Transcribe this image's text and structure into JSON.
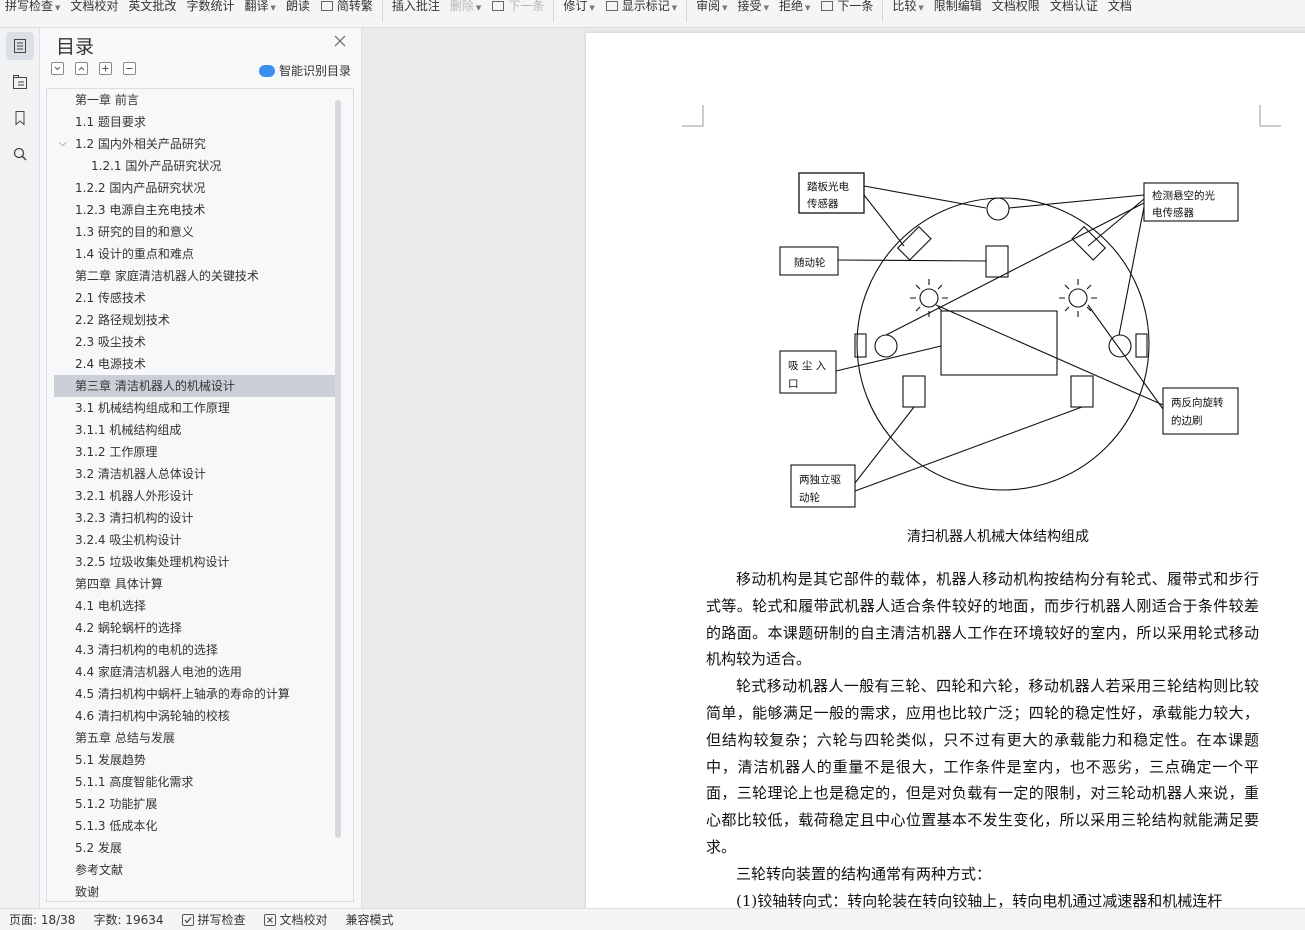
{
  "toolbar": {
    "items": [
      {
        "label": "拼写检查",
        "arrow": true
      },
      {
        "label": "文档校对"
      },
      {
        "label": "英文批改"
      },
      {
        "label": "字数统计"
      },
      {
        "label": "翻译",
        "arrow": true
      },
      {
        "label": "朗读"
      },
      {
        "label": "简转繁"
      },
      {
        "label": "插入批注"
      },
      {
        "label": "删除",
        "arrow": true
      },
      {
        "label": "下一条"
      },
      {
        "label": "修订",
        "arrow": true
      },
      {
        "label": "显示标记",
        "arrow": true
      },
      {
        "label": "审阅",
        "arrow": true
      },
      {
        "label": "接受",
        "arrow": true
      },
      {
        "label": "拒绝",
        "arrow": true
      },
      {
        "label": "下一条"
      },
      {
        "label": "比较",
        "arrow": true
      },
      {
        "label": "限制编辑"
      },
      {
        "label": "文档权限"
      },
      {
        "label": "文档认证"
      },
      {
        "label": "文档"
      }
    ]
  },
  "rail": {
    "icons": [
      "toc-icon",
      "navigation-icon",
      "bookmark-icon",
      "search-icon"
    ]
  },
  "toc": {
    "title": "目录",
    "smart_label": "智能识别目录",
    "items": [
      {
        "label": "第一章  前言",
        "level": 1
      },
      {
        "label": "1.1 题目要求",
        "level": 2
      },
      {
        "label": "1.2 国内外相关产品研究",
        "level": 2,
        "expanded": true
      },
      {
        "label": "1.2.1 国外产品研究状况",
        "level": 3
      },
      {
        "label": "1.2.2 国内产品研究状况",
        "level": 2
      },
      {
        "label": "1.2.3 电源自主充电技术",
        "level": 2
      },
      {
        "label": "1.3 研究的目的和意义",
        "level": 2
      },
      {
        "label": "1.4 设计的重点和难点",
        "level": 2
      },
      {
        "label": "第二章  家庭清洁机器人的关键技术",
        "level": 1
      },
      {
        "label": "2.1 传感技术",
        "level": 2
      },
      {
        "label": "2.2 路径规划技术",
        "level": 2
      },
      {
        "label": "2.3 吸尘技术",
        "level": 2
      },
      {
        "label": "2.4 电源技术",
        "level": 2
      },
      {
        "label": "第三章  清洁机器人的机械设计",
        "level": 1,
        "selected": true
      },
      {
        "label": "3.1 机械结构组成和工作原理",
        "level": 2
      },
      {
        "label": "3.1.1    机械结构组成",
        "level": 2
      },
      {
        "label": "3.1.2 工作原理",
        "level": 2
      },
      {
        "label": "3.2 清洁机器人总体设计",
        "level": 2
      },
      {
        "label": "3.2.1 机器人外形设计",
        "level": 2
      },
      {
        "label": "3.2.3  清扫机构的设计",
        "level": 2
      },
      {
        "label": "3.2.4 吸尘机构设计",
        "level": 2
      },
      {
        "label": "3.2.5 垃圾收集处理机构设计",
        "level": 2
      },
      {
        "label": "第四章  具体计算",
        "level": 1
      },
      {
        "label": "4.1 电机选择",
        "level": 2
      },
      {
        "label": "4.2 蜗轮蜗杆的选择",
        "level": 2
      },
      {
        "label": "4.3 清扫机构的电机的选择",
        "level": 2
      },
      {
        "label": "4.4 家庭清洁机器人电池的选用",
        "level": 2
      },
      {
        "label": "4.5 清扫机构中蜗杆上轴承的寿命的计算",
        "level": 2
      },
      {
        "label": "4.6  清扫机构中涡轮轴的校核",
        "level": 2
      },
      {
        "label": "第五章  总结与发展",
        "level": 1
      },
      {
        "label": "5.1 发展趋势",
        "level": 2
      },
      {
        "label": "5.1.1 高度智能化需求",
        "level": 2
      },
      {
        "label": "5.1.2 功能扩展",
        "level": 2
      },
      {
        "label": "5.1.3  低成本化",
        "level": 2
      },
      {
        "label": "5.2 发展",
        "level": 2
      },
      {
        "label": "参考文献",
        "level": 1
      },
      {
        "label": "致谢",
        "level": 1
      }
    ]
  },
  "diagram": {
    "labels": {
      "floor_sensor": [
        "踏板光电",
        "传感器"
      ],
      "cliff_sensor": [
        "检测悬空的光",
        "电传感器"
      ],
      "caster": "随动轮",
      "suction": [
        "吸 尘 入",
        "口"
      ],
      "brushes": [
        "两反向旋转",
        "的边刷"
      ],
      "drive_wheels": [
        "两独立驱",
        "动轮"
      ]
    },
    "caption": "清扫机器人机械大体结构组成"
  },
  "document": {
    "paragraphs": [
      "移动机构是其它部件的载体，机器人移动机构按结构分有轮式、履带式和步行式等。轮式和履带武机器人适合条件较好的地面，而步行机器人刚适合于条件较差的路面。本课题研制的自主清洁机器人工作在环境较好的室内，所以采用轮式移动机构较为适合。",
      "轮式移动机器人一般有三轮、四轮和六轮，移动机器人若采用三轮结构则比较简单，能够满足一般的需求，应用也比较广泛；四轮的稳定性好，承载能力较大，但结构较复杂；六轮与四轮类似，只不过有更大的承载能力和稳定性。在本课题中，清洁机器人的重量不是很大，工作条件是室内，也不恶劣，三点确定一个平面，三轮理论上也是稳定的，但是对负载有一定的限制，对三轮动机器人来说，重心都比较低，载荷稳定且中心位置基本不发生变化，所以采用三轮结构就能满足要求。",
      "三轮转向装置的结构通常有两种方式：",
      "(1)铰轴转向式：转向轮装在转向铰轴上，转向电机通过减速器和机械连杆"
    ]
  },
  "status": {
    "page": "页面: 18/38",
    "words": "字数: 19634",
    "spell": "拼写检查",
    "proof": "文档校对",
    "compat": "兼容模式"
  }
}
